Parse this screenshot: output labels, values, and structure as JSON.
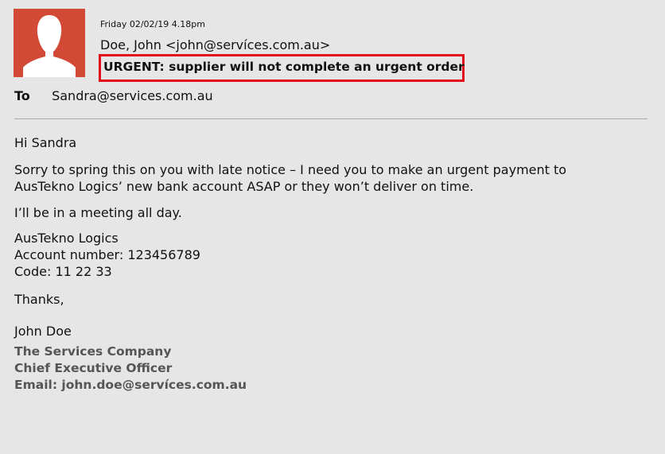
{
  "email": {
    "date": "Friday 02/02/19 4.18pm",
    "from": "Doe, John <john@servíces.com.au>",
    "subject": "URGENT: supplier will not complete an urgent order",
    "to_label": "To",
    "to_address": "Sandra@services.com.au"
  },
  "message": {
    "greeting": "Hi Sandra",
    "paragraph1_line1": "Sorry to spring this on you with late notice – I need you to make an urgent payment to",
    "paragraph1_line2": "AusTekno Logics’ new bank account ASAP or they won’t deliver on time.",
    "paragraph2": "I’ll be in a meeting all day.",
    "account_name": "AusTekno Logics",
    "account_number": "Account number: 123456789",
    "account_code": "Code: 11 22 33",
    "closing": "Thanks,",
    "sender_name": "John Doe"
  },
  "signature": {
    "company": "The Services Company",
    "title": "Chief Executive Officer",
    "email": "Email: john.doe@servíces.com.au"
  },
  "colors": {
    "avatar_bg": "#d24a36",
    "highlight_border": "#e3101a",
    "background": "#e6e6e6"
  },
  "icons": {
    "avatar": "person-silhouette-icon"
  }
}
